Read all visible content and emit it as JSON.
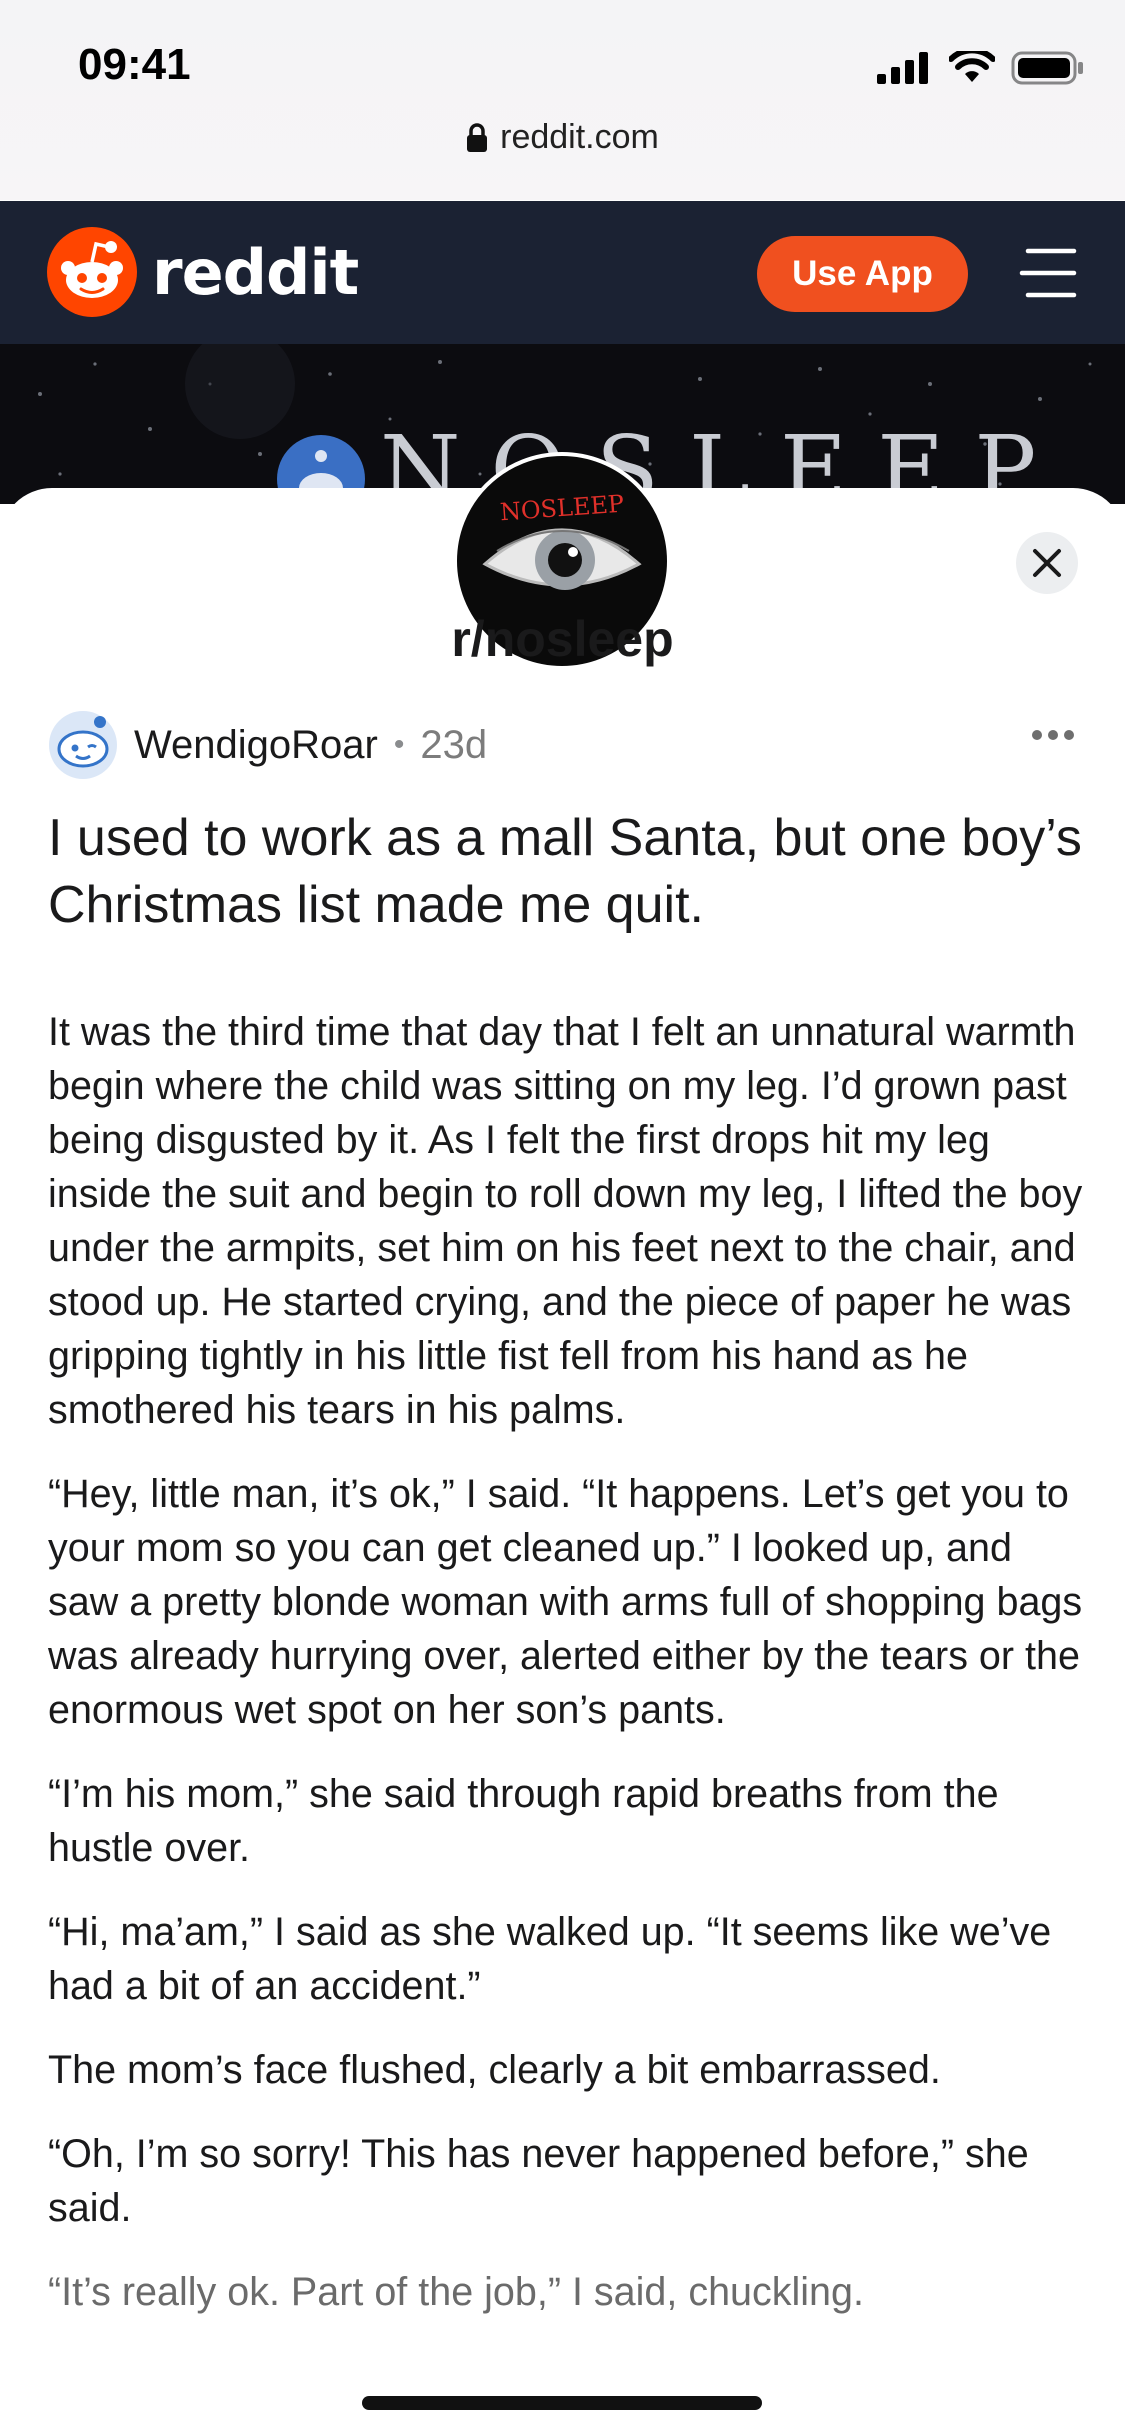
{
  "status_bar": {
    "time": "09:41"
  },
  "browser": {
    "url": "reddit.com"
  },
  "header": {
    "logo_text": "reddit",
    "use_app_label": "Use App",
    "brand_color": "#ff4500",
    "bar_color": "#1b2233"
  },
  "community": {
    "name": "r/nosleep",
    "banner_text": "NOSLEEP",
    "avatar_text": "NOSLEEP"
  },
  "post": {
    "author": "WendigoRoar",
    "separator": "•",
    "age": "23d",
    "title": "I used to work as a mall Santa, but one boy’s Christmas list made me quit.",
    "paragraphs": [
      "It was the third time that day that I felt an unnatural warmth begin where the child was sitting on my leg. I’d grown past being disgusted by it. As I felt the first drops hit my leg inside the suit and begin to roll down my leg, I lifted the boy under the armpits, set him on his feet next to the chair, and stood up. He started crying, and the piece of paper he was gripping tightly in his little fist fell from his hand as he smothered his tears in his palms.",
      "“Hey, little man, it’s ok,” I said. “It happens. Let’s get you to your mom so you can get cleaned up.” I looked up, and saw a pretty blonde woman with arms full of shopping bags was already hurrying over, alerted either by the tears or the enormous wet spot on her son’s pants.",
      "“I’m his mom,” she said through rapid breaths from the hustle over.",
      "“Hi, ma’am,” I said as she walked up. “It seems like we’ve had a bit of an accident.”",
      "The mom’s face flushed, clearly a bit embarrassed.",
      "“Oh, I’m so sorry! This has never happened before,” she said.",
      "“It’s really ok. Part of the job,” I said, chuckling."
    ]
  },
  "icons": {
    "lock": "lock-icon",
    "signal": "signal-icon",
    "wifi": "wifi-icon",
    "battery": "battery-icon",
    "menu": "hamburger-menu-icon",
    "close": "close-icon",
    "more": "more-options-icon",
    "author_avatar": "snoo-avatar-icon"
  }
}
